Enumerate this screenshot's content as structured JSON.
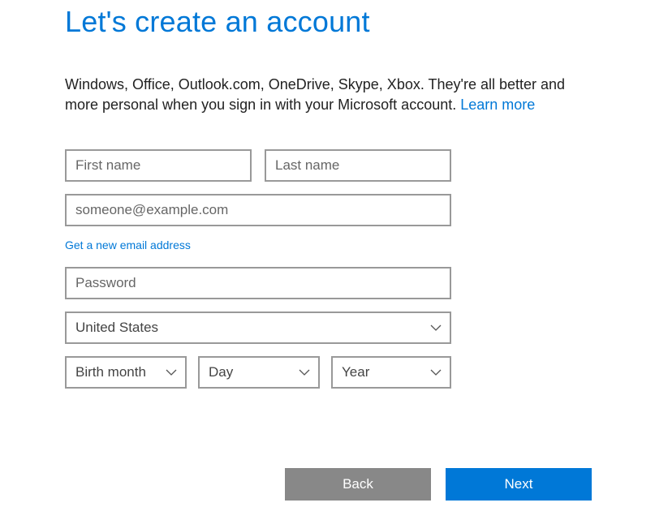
{
  "title": "Let's create an account",
  "description_text": "Windows, Office, Outlook.com, OneDrive, Skype, Xbox. They're all better and more personal when you sign in with your Microsoft account. ",
  "description_link": "Learn more",
  "fields": {
    "first_name_placeholder": "First name",
    "last_name_placeholder": "Last name",
    "email_placeholder": "someone@example.com",
    "password_placeholder": "Password"
  },
  "new_email_link": "Get a new email address",
  "country": {
    "selected": "United States"
  },
  "birth": {
    "month": "Birth month",
    "day": "Day",
    "year": "Year"
  },
  "buttons": {
    "back": "Back",
    "next": "Next"
  },
  "colors": {
    "accent": "#0078d7",
    "back_button": "#888888"
  }
}
